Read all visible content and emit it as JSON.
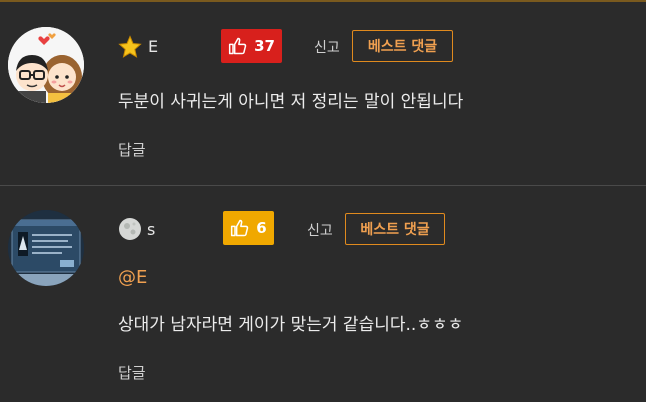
{
  "comments": [
    {
      "user_name": "E",
      "user_icon": "star-icon",
      "likes": "37",
      "like_color": "#d8201c",
      "report_label": "신고",
      "badge_label": "베스트 댓글",
      "text": "두분이 사귀는게 아니면 저 정리는 말이 안됩니다",
      "reply_label": "답글"
    },
    {
      "user_name": "s",
      "user_icon": "moon-icon",
      "likes": "6",
      "like_color": "#f0a800",
      "report_label": "신고",
      "badge_label": "베스트 댓글",
      "mention": "@E",
      "text": "상대가 남자라면 게이가 맞는거 같습니다..ㅎㅎㅎ",
      "reply_label": "답글"
    }
  ],
  "colors": {
    "background": "#2b2b2b",
    "accent": "#f0a050"
  }
}
